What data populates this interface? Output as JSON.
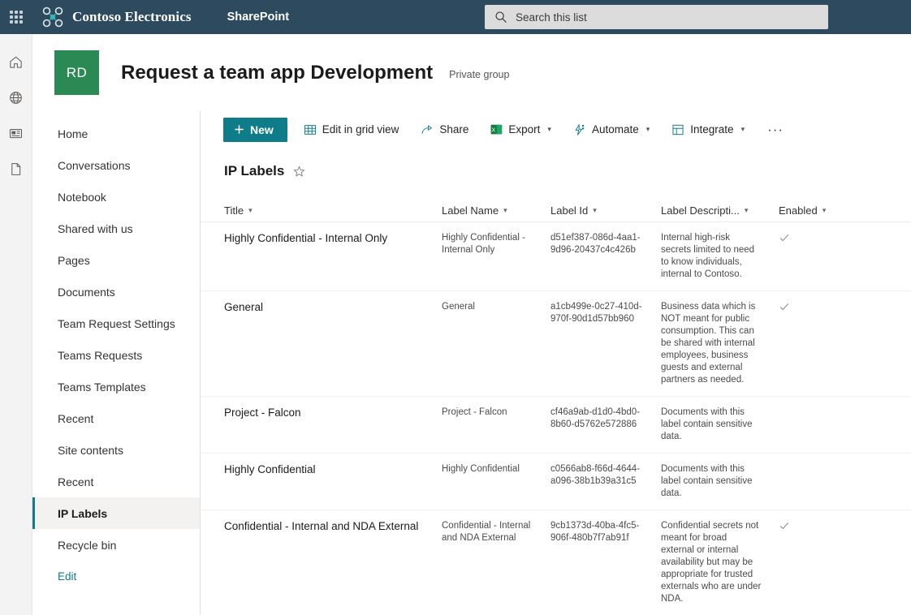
{
  "suite": {
    "waffle_label": "App launcher",
    "brand": "Contoso Electronics",
    "app": "SharePoint",
    "search_placeholder": "Search this list",
    "search_value": "",
    "bar_color": "#2d4a5e",
    "logo_color": "#37b5b5"
  },
  "rail": {
    "items": [
      {
        "name": "home-icon",
        "label": "Home"
      },
      {
        "name": "globe-icon",
        "label": "Global"
      },
      {
        "name": "news-icon",
        "label": "News"
      },
      {
        "name": "document-icon",
        "label": "Files"
      }
    ]
  },
  "site": {
    "avatar_initials": "RD",
    "avatar_color": "#2b8a54",
    "title": "Request a team app Development",
    "privacy": "Private group"
  },
  "nav": {
    "items": [
      {
        "label": "Home",
        "selected": false,
        "link": false
      },
      {
        "label": "Conversations",
        "selected": false,
        "link": false
      },
      {
        "label": "Notebook",
        "selected": false,
        "link": false
      },
      {
        "label": "Shared with us",
        "selected": false,
        "link": false
      },
      {
        "label": "Pages",
        "selected": false,
        "link": false
      },
      {
        "label": "Documents",
        "selected": false,
        "link": false
      },
      {
        "label": "Team Request Settings",
        "selected": false,
        "link": false
      },
      {
        "label": "Teams Requests",
        "selected": false,
        "link": false
      },
      {
        "label": "Teams Templates",
        "selected": false,
        "link": false
      },
      {
        "label": "Recent",
        "selected": false,
        "link": false
      },
      {
        "label": "Site contents",
        "selected": false,
        "link": false
      },
      {
        "label": "Recent",
        "selected": false,
        "link": false
      },
      {
        "label": "IP Labels",
        "selected": true,
        "link": false
      },
      {
        "label": "Recycle bin",
        "selected": false,
        "link": false
      },
      {
        "label": "Edit",
        "selected": false,
        "link": true
      }
    ],
    "accent_color": "#0f7c8a"
  },
  "toolbar": {
    "new_label": "New",
    "new_color": "#0f7c8a",
    "edit_grid_label": "Edit in grid view",
    "share_label": "Share",
    "export_label": "Export",
    "automate_label": "Automate",
    "integrate_label": "Integrate",
    "overflow_label": "···"
  },
  "list": {
    "title": "IP Labels",
    "favorite_label": "Add to favorites",
    "columns": [
      {
        "label": "Title"
      },
      {
        "label": "Label Name"
      },
      {
        "label": "Label Id"
      },
      {
        "label": "Label Descripti..."
      },
      {
        "label": "Enabled"
      }
    ],
    "rows": [
      {
        "title": "Highly Confidential - Internal Only",
        "label_name": "Highly Confidential - Internal Only",
        "label_id": "d51ef387-086d-4aa1-9d96-20437c4c426b",
        "description": "Internal high-risk secrets limited to need to know individuals, internal to Contoso.",
        "enabled": true
      },
      {
        "title": "General",
        "label_name": "General",
        "label_id": "a1cb499e-0c27-410d-970f-90d1d57bb960",
        "description": "Business data which is NOT meant for public consumption. This can be shared with internal employees, business guests and external partners as needed.",
        "enabled": true
      },
      {
        "title": "Project - Falcon",
        "label_name": "Project - Falcon",
        "label_id": "cf46a9ab-d1d0-4bd0-8b60-d5762e572886",
        "description": "Documents with this label contain sensitive data.",
        "enabled": false
      },
      {
        "title": "Highly Confidential",
        "label_name": "Highly Confidential",
        "label_id": "c0566ab8-f66d-4644-a096-38b1b39a31c5",
        "description": "Documents with this label contain sensitive data.",
        "enabled": false
      },
      {
        "title": "Confidential - Internal and NDA External",
        "label_name": "Confidential - Internal and NDA External",
        "label_id": "9cb1373d-40ba-4fc5-906f-480b7f7ab91f",
        "description": "Confidential secrets not meant for broad external or internal availability but may be appropriate for trusted externals who are under NDA.",
        "enabled": true
      }
    ]
  }
}
